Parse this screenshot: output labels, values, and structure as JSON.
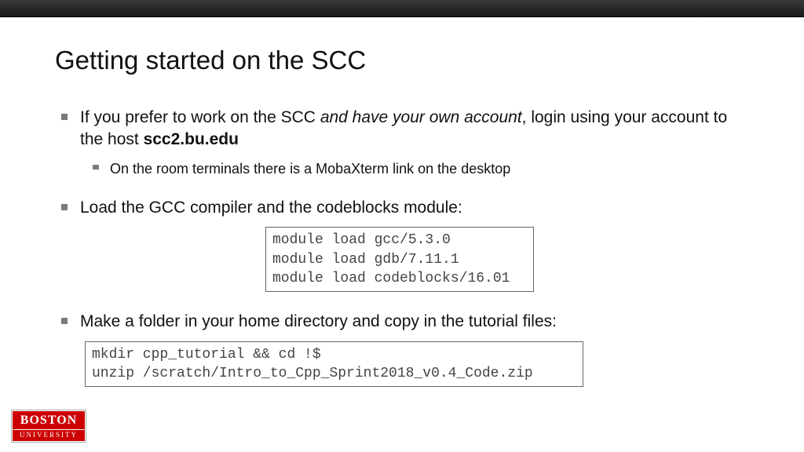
{
  "title": "Getting started on the SCC",
  "bullets": {
    "b1": {
      "pre": "If you prefer to work on the SCC ",
      "italic": "and have your own account",
      "mid": ", login using your account to the host ",
      "bold": "scc2.bu.edu"
    },
    "b1_sub": "On the room terminals there is a MobaXterm link on the desktop",
    "b2": "Load the GCC compiler and the codeblocks module:",
    "b3": "Make a folder in your home directory and copy in the tutorial files:"
  },
  "code1": "module load gcc/5.3.0\nmodule load gdb/7.11.1\nmodule load codeblocks/16.01",
  "code2": "mkdir cpp_tutorial && cd !$\nunzip /scratch/Intro_to_Cpp_Sprint2018_v0.4_Code.zip",
  "logo": {
    "top": "BOSTON",
    "bottom": "UNIVERSITY"
  }
}
